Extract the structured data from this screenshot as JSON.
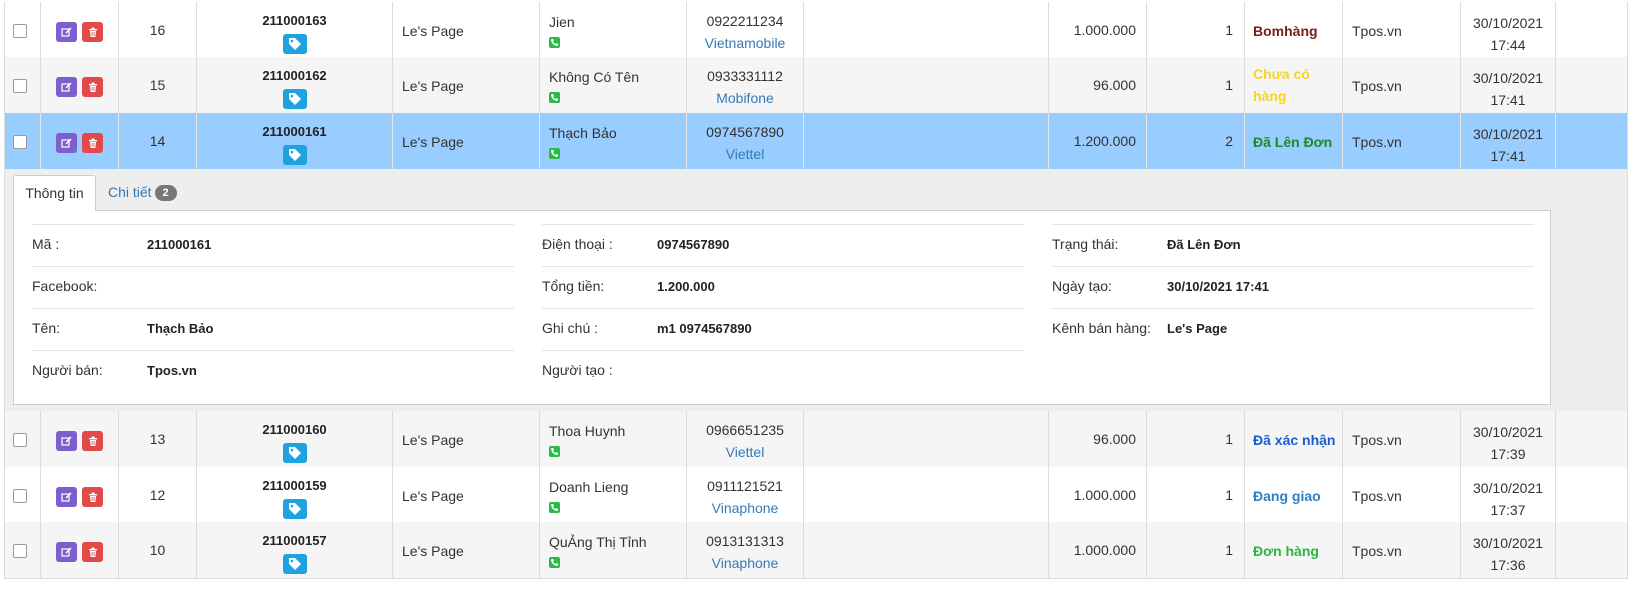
{
  "colors": {
    "selected_row": "#99ccff",
    "edit_button": "#7c5fcc",
    "delete_button": "#e24a4a",
    "tag_button": "#1fa3e0",
    "phone_icon": "#2bb94a",
    "link": "#337ab7"
  },
  "rows": [
    {
      "stt": "16",
      "code": "211000163",
      "page": "Le's Page",
      "customer": "Jien",
      "phone": "0922211234",
      "network": "Vietnamobile",
      "amount": "1.000.000",
      "qty": "1",
      "status": "Bomhàng",
      "status_color": "#7a1c1c",
      "status_lines": [
        "Bomhàng"
      ],
      "seller": "Tpos.vn",
      "date": "30/10/2021",
      "time": "17:44"
    },
    {
      "stt": "15",
      "code": "211000162",
      "page": "Le's Page",
      "customer": "Không Có Tên",
      "phone": "0933331112",
      "network": "Mobifone",
      "amount": "96.000",
      "qty": "1",
      "status": "Chưa có hàng",
      "status_color": "#f5d327",
      "status_lines": [
        "Chưa có",
        "hàng"
      ],
      "seller": "Tpos.vn",
      "date": "30/10/2021",
      "time": "17:41"
    },
    {
      "stt": "14",
      "code": "211000161",
      "page": "Le's Page",
      "customer": "Thạch Bảo",
      "phone": "0974567890",
      "network": "Viettel",
      "amount": "1.200.000",
      "qty": "2",
      "status": "Đã Lên Đơn",
      "status_color": "#1a8a2a",
      "status_lines": [
        "Đã Lên Đơn"
      ],
      "seller": "Tpos.vn",
      "date": "30/10/2021",
      "time": "17:41"
    },
    {
      "stt": "13",
      "code": "211000160",
      "page": "Le's Page",
      "customer": "Thoa Huynh",
      "phone": "0966651235",
      "network": "Viettel",
      "amount": "96.000",
      "qty": "1",
      "status": "Đã xác nhận",
      "status_color": "#1a5ccf",
      "status_lines": [
        "Đã xác nhận"
      ],
      "seller": "Tpos.vn",
      "date": "30/10/2021",
      "time": "17:39"
    },
    {
      "stt": "12",
      "code": "211000159",
      "page": "Le's Page",
      "customer": "Doanh Lieng",
      "phone": "0911121521",
      "network": "Vinaphone",
      "amount": "1.000.000",
      "qty": "1",
      "status": "Đang giao",
      "status_color": "#2f7fc1",
      "status_lines": [
        "Đang giao"
      ],
      "seller": "Tpos.vn",
      "date": "30/10/2021",
      "time": "17:37"
    },
    {
      "stt": "10",
      "code": "211000157",
      "page": "Le's Page",
      "customer": "QuẢng Thị Tỉnh",
      "phone": "0913131313",
      "network": "Vinaphone",
      "amount": "1.000.000",
      "qty": "1",
      "status": "Đơn hàng",
      "status_color": "#2ab53b",
      "status_lines": [
        "Đơn hàng"
      ],
      "seller": "Tpos.vn",
      "date": "30/10/2021",
      "time": "17:36"
    }
  ],
  "detail": {
    "tab_info": "Thông tin",
    "tab_detail": "Chi tiết",
    "tab_detail_count": "2",
    "col1": [
      {
        "label": "Mã :",
        "value": "211000161"
      },
      {
        "label": "Facebook:",
        "value": ""
      },
      {
        "label": "Tên:",
        "value": "Thạch Bảo"
      },
      {
        "label": "Người bán:",
        "value": "Tpos.vn"
      }
    ],
    "col2": [
      {
        "label": "Điện thoại :",
        "value": "0974567890"
      },
      {
        "label": "Tổng tiền:",
        "value": "1.200.000"
      },
      {
        "label": "Ghi chú :",
        "value": "m1 0974567890"
      },
      {
        "label": "Người tạo :",
        "value": ""
      }
    ],
    "col3": [
      {
        "label": "Trạng thái:",
        "value": "Đã Lên Đơn"
      },
      {
        "label": "Ngày tạo:",
        "value": "30/10/2021 17:41"
      },
      {
        "label": "Kênh bán hàng:",
        "value": "Le's Page"
      }
    ]
  }
}
